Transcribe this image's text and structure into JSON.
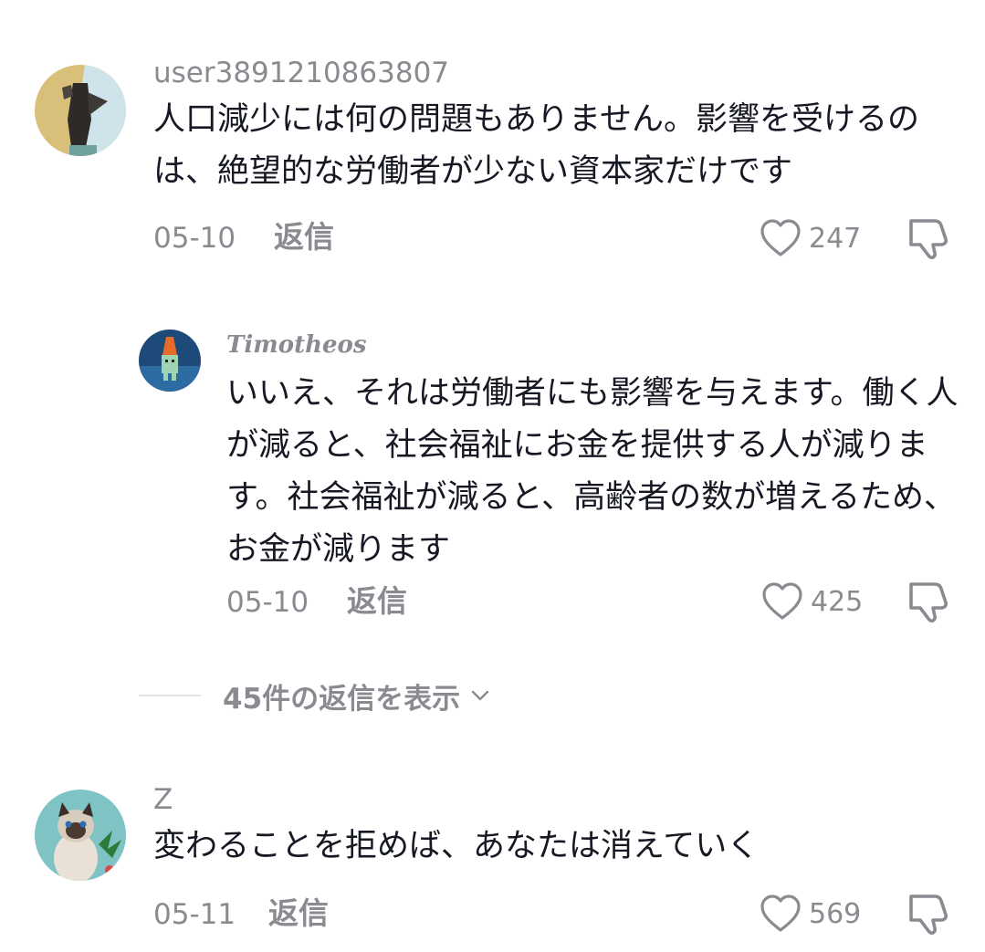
{
  "comments": [
    {
      "username": "user3891210863807",
      "text": "人口減少には何の問題もありません。影響を受けるのは、絶望的な労働者が少ない資本家だけです",
      "date": "05-10",
      "reply_label": "返信",
      "likes": "247",
      "avatar_icon": "statue-of-liberty-avatar"
    },
    {
      "username": "Timotheos",
      "text": "いいえ、それは労働者にも影響を与えます。働く人が減ると、社会福祉にお金を提供する人が減ります。社会福祉が減ると、高齢者の数が増えるため、お金が減ります",
      "date": "05-10",
      "reply_label": "返信",
      "likes": "425",
      "avatar_icon": "pixel-character-avatar"
    },
    {
      "username": "Z",
      "text": "変わることを拒めば、あなたは消えていく",
      "date": "05-11",
      "reply_label": "返信",
      "likes": "569",
      "avatar_icon": "siamese-cat-avatar"
    }
  ],
  "view_replies": {
    "label": "45件の返信を表示"
  },
  "colors": {
    "text": "#161823",
    "muted": "#8a8b91",
    "divider": "#e3e3e4"
  }
}
